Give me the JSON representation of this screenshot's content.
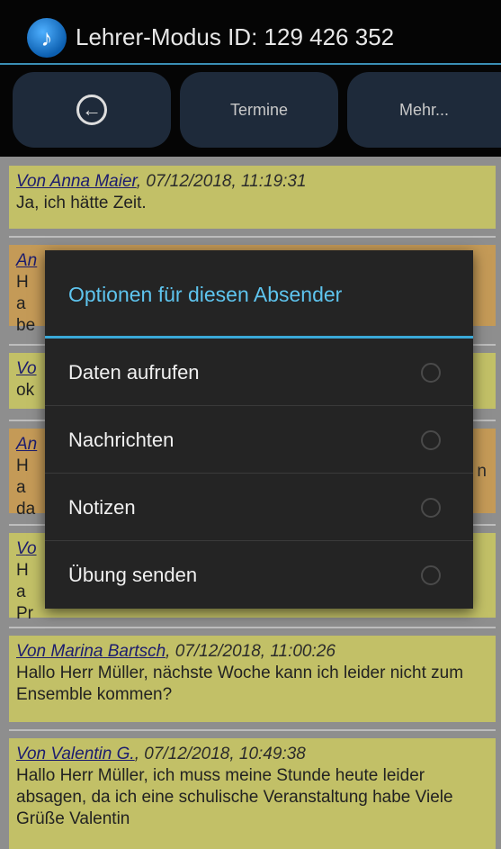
{
  "titlebar": {
    "icon": "music-note-icon",
    "title": "Lehrer-Modus ID: 129 426 352"
  },
  "navbar": {
    "back_icon": "back-arrow-circle-icon",
    "termine": "Termine",
    "mehr": "Mehr..."
  },
  "messages": [
    {
      "sender": "Von Anna Maier",
      "meta": ", 07/12/2018, 11:19:31",
      "body": "Ja, ich hätte Zeit."
    },
    {
      "sender": "An",
      "meta": "",
      "body": "Ha be"
    },
    {
      "sender": "Vo",
      "meta": "",
      "body": "ok"
    },
    {
      "sender": "An",
      "meta": "",
      "body": "Ha da",
      "body_right": "n"
    },
    {
      "sender": "Vo",
      "meta": "",
      "body": "Ha Pr"
    },
    {
      "sender": "Von Marina Bartsch",
      "meta": ", 07/12/2018, 11:00:26",
      "body": "Hallo Herr Müller, nächste Woche kann ich leider nicht zum Ensemble kommen?"
    },
    {
      "sender": "Von Valentin G.",
      "meta": ", 07/12/2018, 10:49:38",
      "body": "Hallo Herr Müller, ich muss meine Stunde heute leider absagen, da ich eine schulische Veranstaltung habe Viele Grüße Valentin"
    }
  ],
  "dialog": {
    "title": "Optionen für diesen Absender",
    "options": [
      "Daten aufrufen",
      "Nachrichten",
      "Notizen",
      "Übung senden"
    ]
  }
}
